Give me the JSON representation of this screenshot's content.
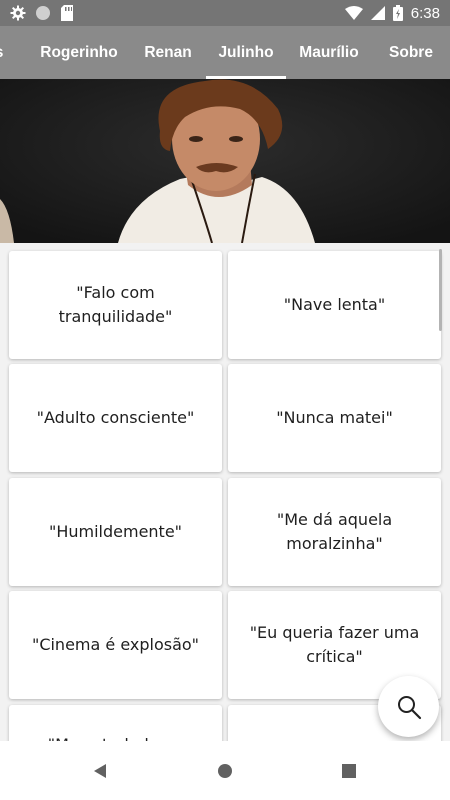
{
  "status_bar": {
    "time": "6:38",
    "left_icons": [
      "gear-icon",
      "circle-icon",
      "sd-card-icon"
    ],
    "right_icons": [
      "wifi-icon",
      "signal-icon",
      "battery-icon"
    ]
  },
  "tabs": [
    {
      "label": "s",
      "active": false
    },
    {
      "label": "Rogerinho",
      "active": false
    },
    {
      "label": "Renan",
      "active": false
    },
    {
      "label": "Julinho",
      "active": true
    },
    {
      "label": "Maurílio",
      "active": false
    },
    {
      "label": "Sobre",
      "active": false
    }
  ],
  "cards": [
    "\"Falo com tranquilidade\"",
    "\"Nave lenta\"",
    "\"Adulto consciente\"",
    "\"Nunca matei\"",
    "\"Humildemente\"",
    "\"Me dá aquela moralzinha\"",
    "\"Cinema é explosão\"",
    "\"Eu queria fazer uma crítica\"",
    "\"Mas atrelado ao",
    ""
  ],
  "fab_icon": "search-icon",
  "nav_icons": [
    "back-icon",
    "home-icon",
    "recents-icon"
  ],
  "colors": {
    "status_bar": "#757575",
    "tab_bar": "#8a8a8a",
    "card": "#ffffff",
    "background": "#f2f2f2"
  }
}
